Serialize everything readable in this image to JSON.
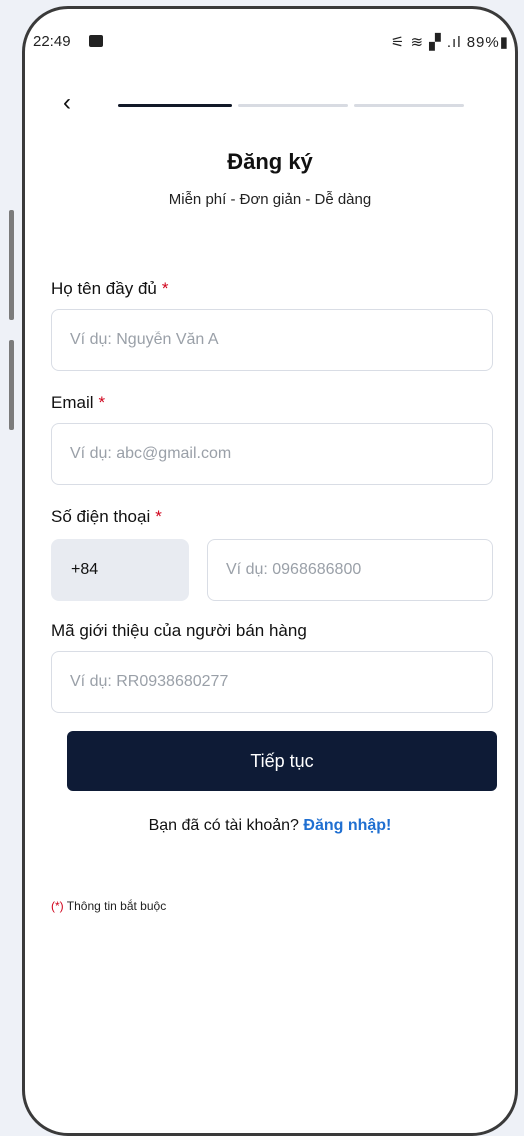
{
  "status_bar": {
    "time": "22:49",
    "indicators": "⚟ ≋ ▞ .ıl 89%▮"
  },
  "header": {
    "back_icon": "chevron-left-icon",
    "title": "Đăng ký",
    "subtitle": "Miễn phí - Đơn giản - Dễ dàng",
    "steps": [
      {
        "state": "active"
      },
      {
        "state": "inactive"
      },
      {
        "state": "inactive"
      }
    ]
  },
  "form": {
    "full_name": {
      "label": "Họ tên đầy đủ",
      "required_mark": "*",
      "placeholder": "Ví dụ: Nguyễn Văn A",
      "value": ""
    },
    "email": {
      "label": "Email",
      "required_mark": "*",
      "placeholder": "Ví dụ: abc@gmail.com",
      "value": ""
    },
    "phone": {
      "label": "Số điện thoại",
      "required_mark": "*",
      "country_code": "+84",
      "placeholder": "Ví dụ: 0968686800",
      "value": ""
    },
    "referral": {
      "label": "Mã giới thiệu của người bán hàng",
      "placeholder": "Ví dụ: RR0938680277",
      "value": ""
    },
    "submit_label": "Tiếp tục"
  },
  "login_prompt": {
    "text": "Bạn đã có tài khoản?",
    "link": "Đăng nhập!"
  },
  "footnote": {
    "mark": "(*)",
    "text": "Thông tin bắt buộc"
  },
  "colors": {
    "primary": "#0e1b36",
    "link": "#1f6fd1",
    "required": "#d0021b"
  }
}
